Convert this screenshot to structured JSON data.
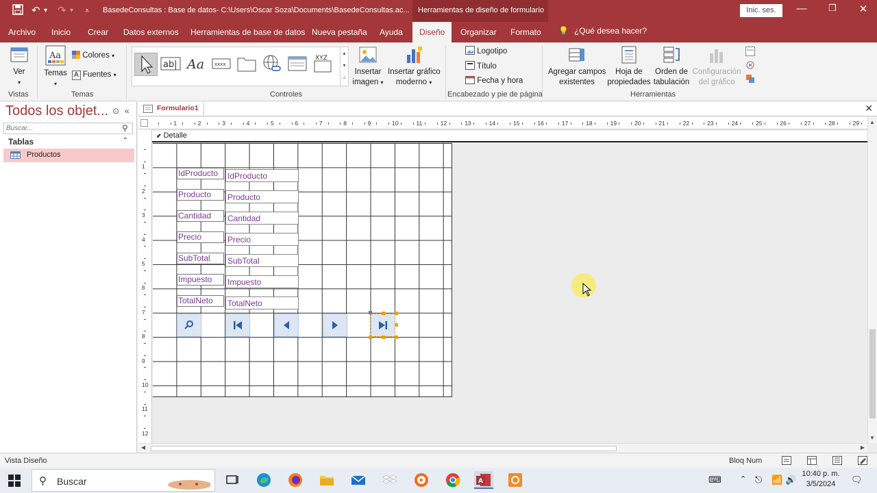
{
  "titlebar": {
    "title": "BasedeConsultas : Base de datos- C:\\Users\\Oscar Soza\\Documents\\BasedeConsultas.ac...",
    "context_tab": "Herramientas de diseño de formulario",
    "signin": "Inic. ses."
  },
  "menu": {
    "tabs": [
      "Archivo",
      "Inicio",
      "Crear",
      "Datos externos",
      "Herramientas de base de datos",
      "Nueva pestaña",
      "Ayuda",
      "Diseño",
      "Organizar",
      "Formato"
    ],
    "active": "Diseño",
    "help": "¿Qué desea hacer?"
  },
  "ribbon": {
    "groups": {
      "vistas": "Vistas",
      "temas": "Temas",
      "controles": "Controles",
      "encabezado": "Encabezado y pie de página",
      "herramientas": "Herramientas"
    },
    "ver": "Ver",
    "temas_btn": "Temas",
    "colores": "Colores",
    "fuentes": "Fuentes",
    "insertar_imagen_1": "Insertar",
    "insertar_imagen_2": "imagen",
    "insertar_grafico_1": "Insertar gráfico",
    "insertar_grafico_2": "moderno",
    "logotipo": "Logotipo",
    "titulo": "Título",
    "fecha_hora": "Fecha y hora",
    "agregar_1": "Agregar campos",
    "agregar_2": "existentes",
    "hoja_1": "Hoja de",
    "hoja_2": "propiedades",
    "orden_1": "Orden de",
    "orden_2": "tabulación",
    "config_1": "Configuración",
    "config_2": "del gráfico",
    "ctrl_xxxx": "xxxx",
    "ctrl_xyz": "XYZ",
    "ctrl_aa": "Aa",
    "ctrl_ab": "ab|"
  },
  "nav": {
    "title": "Todos los objet...",
    "search_placeholder": "Buscar...",
    "section": "Tablas",
    "items": [
      "Productos"
    ]
  },
  "document": {
    "tab": "Formulario1",
    "section": "Detalle",
    "ruler_h": [
      "1",
      "2",
      "3",
      "4",
      "5",
      "6",
      "7",
      "8",
      "9",
      "10",
      "11",
      "12",
      "13",
      "14",
      "15",
      "16",
      "17",
      "18",
      "19",
      "20",
      "21",
      "22",
      "23",
      "24",
      "25",
      "26",
      "27",
      "28",
      "29"
    ],
    "ruler_v": [
      "1",
      "2",
      "3",
      "4",
      "5",
      "6",
      "7",
      "8",
      "9",
      "10",
      "11",
      "12"
    ],
    "fields": [
      {
        "label": "IdProducto",
        "text": "IdProducto"
      },
      {
        "label": "Producto",
        "text": "Producto"
      },
      {
        "label": "Cantidad",
        "text": "Cantidad"
      },
      {
        "label": "Precio",
        "text": "Precio"
      },
      {
        "label": "SubTotal",
        "text": "SubTotal"
      },
      {
        "label": "Impuesto",
        "text": "Impuesto"
      },
      {
        "label": "TotalNeto",
        "text": "TotalNeto"
      }
    ]
  },
  "status": {
    "left": "Vista Diseño",
    "bloq": "Bloq Num"
  },
  "taskbar": {
    "search": "Buscar",
    "time": "10:40 p. m.",
    "date": "3/5/2024"
  },
  "colors": {
    "accent": "#a4373a",
    "nav_selected": "#f8c9c9",
    "label_text": "#7a3a92"
  }
}
